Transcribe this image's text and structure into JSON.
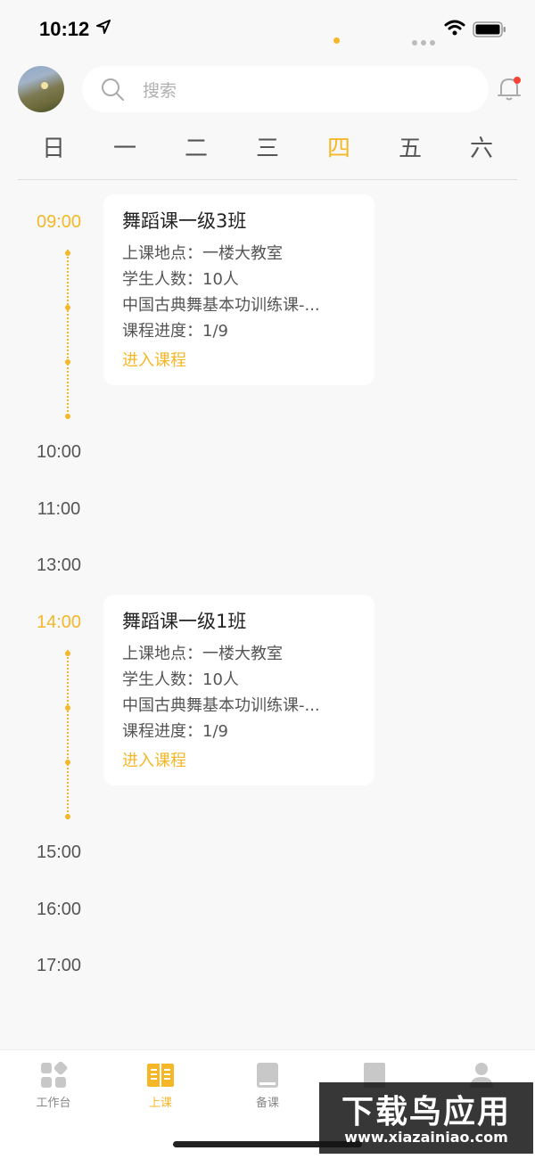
{
  "status": {
    "time": "10:12"
  },
  "search": {
    "placeholder": "搜索"
  },
  "week": {
    "days": [
      "日",
      "一",
      "二",
      "三",
      "四",
      "五",
      "六"
    ],
    "selected_index": 4
  },
  "schedule": {
    "times": [
      "09:00",
      "10:00",
      "11:00",
      "13:00",
      "14:00",
      "15:00",
      "16:00",
      "17:00"
    ],
    "active_times": [
      "09:00",
      "14:00"
    ],
    "courses": [
      {
        "time": "09:00",
        "title": "舞蹈课一级3班",
        "location": "上课地点：一楼大教室",
        "students": "学生人数：10人",
        "curriculum": "中国古典舞基本功训练课-...",
        "progress": "课程进度：1/9",
        "action": "进入课程"
      },
      {
        "time": "14:00",
        "title": "舞蹈课一级1班",
        "location": "上课地点：一楼大教室",
        "students": "学生人数：10人",
        "curriculum": "中国古典舞基本功训练课-...",
        "progress": "课程进度：1/9",
        "action": "进入课程"
      }
    ]
  },
  "tabbar": {
    "items": [
      {
        "label": "工作台",
        "icon": "dashboard-icon"
      },
      {
        "label": "上课",
        "icon": "open-book-icon"
      },
      {
        "label": "备课",
        "icon": "book-icon"
      },
      {
        "label": "",
        "icon": "document-icon"
      },
      {
        "label": "",
        "icon": "person-icon"
      }
    ],
    "active_index": 1
  },
  "watermark": {
    "title": "下载鸟应用",
    "url": "www.xiazainiao.com"
  },
  "colors": {
    "accent": "#f5b728",
    "background": "#f8f8f8",
    "badge": "#f44336"
  }
}
